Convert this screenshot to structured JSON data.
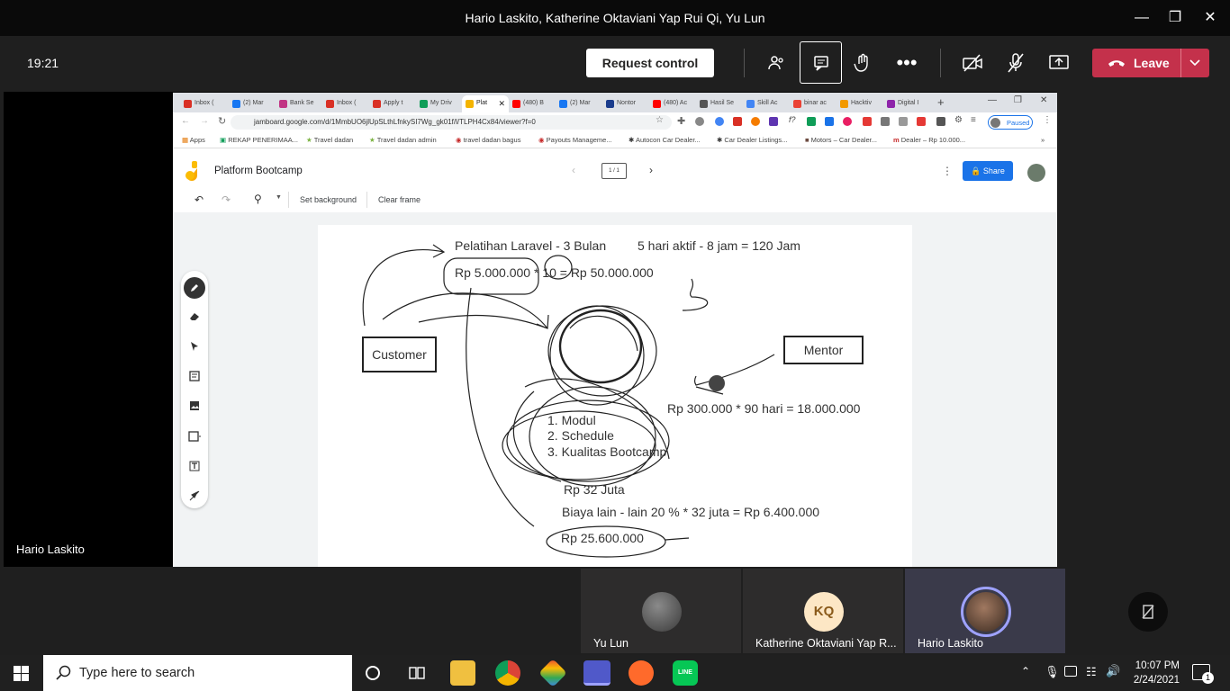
{
  "window": {
    "title": "Hario Laskito, Katherine Oktaviani Yap Rui Qi, Yu Lun"
  },
  "meeting": {
    "timer": "19:21",
    "request_control_label": "Request control",
    "leave_label": "Leave",
    "presenter_name": "Hario Laskito"
  },
  "browser": {
    "tabs": [
      "Inbox (",
      "(2) Mar",
      "Bank Se",
      "Inbox (",
      "Apply t",
      "My Driv",
      "Plat",
      "(480) B",
      "(2) Mar",
      "Nontor",
      "(480) Ac",
      "Hasil Se",
      "Skill Ac",
      "binar ac",
      "Hacktiv",
      "Digital I"
    ],
    "url": "jamboard.google.com/d/1MmbUO6jlUpSLthLfnkySI7Wg_gk01f/l/TLPH4Cx84/viewer?f=0",
    "paused_label": "Paused",
    "bookmarks": [
      "Apps",
      "REKAP PENERIMAA...",
      "Travel dadan",
      "Travel dadan admin",
      "travel dadan bagus",
      "Payouts Manageme...",
      "Autocon Car Dealer...",
      "Car Dealer Listings...",
      "Motors – Car Dealer...",
      "Dealer – Rp 10.000..."
    ]
  },
  "jamboard": {
    "title": "Platform Bootcamp",
    "frame_indicator": "1 / 1",
    "share_label": "Share",
    "set_background_label": "Set background",
    "clear_frame_label": "Clear frame",
    "texts": {
      "line1": "Pelatihan Laravel -  3 Bulan",
      "line1b": "5 hari aktif - 8 jam = 120 Jam",
      "line2": "Rp 5.000.000 * 10 = Rp 50.000.000",
      "customer": "Customer",
      "mentor": "Mentor",
      "mentor_cost": "Rp 300.000 * 90 hari = 18.000.000",
      "list1": "1. Modul",
      "list2": "2. Schedule",
      "list3": "3. Kualitas Bootcamp",
      "budget": "Rp 32 Juta",
      "other_cost": "Biaya lain - lain 20 % * 32 juta = Rp 6.400.000",
      "result": "Rp 25.600.000"
    }
  },
  "participants": [
    {
      "name": "Yu Lun",
      "initials": ""
    },
    {
      "name": "Katherine Oktaviani Yap R...",
      "initials": "KQ"
    },
    {
      "name": "Hario Laskito",
      "initials": ""
    }
  ],
  "taskbar": {
    "search_placeholder": "Type here to search",
    "time": "10:07 PM",
    "date": "2/24/2021",
    "notification_count": "1"
  },
  "colors": {
    "leave": "#c4314b",
    "share": "#1a73e8",
    "teams_bg": "#1f1f1f"
  }
}
